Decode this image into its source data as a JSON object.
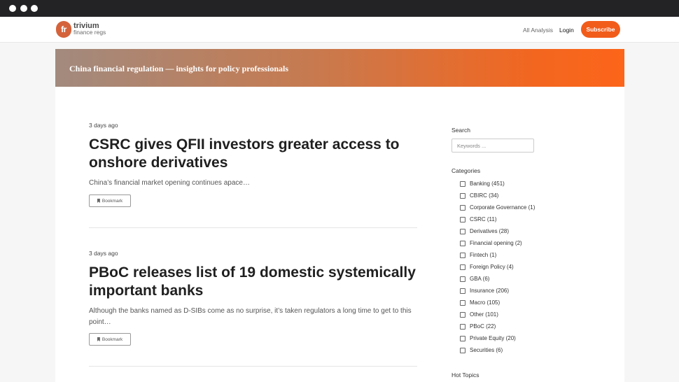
{
  "brand": {
    "logo_mark": "fr",
    "name": "trivium",
    "tagline": "finance regs"
  },
  "nav": {
    "all_analysis": "All Analysis",
    "login": "Login",
    "subscribe": "Subscribe"
  },
  "banner": {
    "text": "China financial regulation — insights for policy professionals"
  },
  "articles": [
    {
      "date": "3 days ago",
      "title_line1": "CSRC gives QFII investors greater access to",
      "title_line2": "onshore derivatives",
      "excerpt_line1": "China’s financial market opening continues apace…",
      "excerpt_line2": "",
      "bookmark": "Bookmark"
    },
    {
      "date": "3 days ago",
      "title_line1": "PBoC releases list of 19 domestic systemically",
      "title_line2": "important banks",
      "excerpt_line1": "Although the banks named as D-SIBs come as no surprise, it’s taken regulators a long time to get to this",
      "excerpt_line2": "point…",
      "bookmark": "Bookmark"
    }
  ],
  "sidebar": {
    "search_heading": "Search",
    "search_placeholder": "Keywords ...",
    "categories_heading": "Categories",
    "categories": [
      "Banking (451)",
      "CBIRC (34)",
      "Corporate Governance (1)",
      "CSRC (11)",
      "Derivatives (28)",
      "Financial opening (2)",
      "Fintech (1)",
      "Foreign Policy (4)",
      "GBA (6)",
      "Insurance (206)",
      "Macro (105)",
      "Other (101)",
      "PBoC (22)",
      "Private Equity (20)",
      "Securities (6)"
    ],
    "hot_topics_heading": "Hot Topics"
  },
  "colors": {
    "accent": "#f25c1b",
    "logo": "#d4633c",
    "chrome": "#232325"
  }
}
